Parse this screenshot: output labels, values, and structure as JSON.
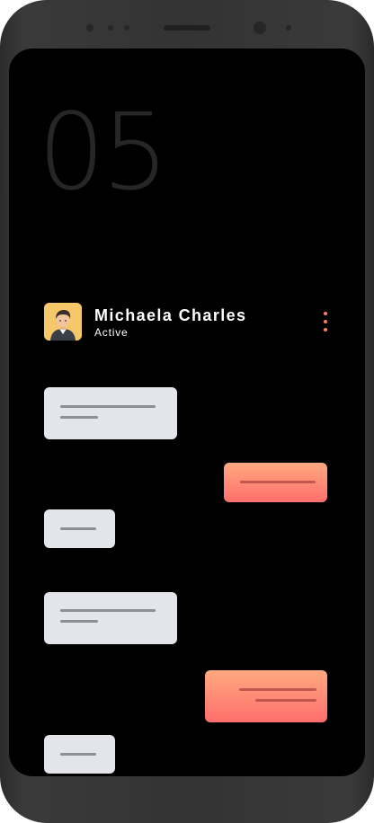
{
  "header": {
    "page_number": "05",
    "contact_name": "Michaela Charles",
    "contact_status": "Active",
    "avatar_icon": "person-avatar-icon",
    "menu_icon": "more-vertical-icon"
  },
  "messages": [
    {
      "direction": "incoming",
      "lines": 2
    },
    {
      "direction": "outgoing",
      "lines": 1
    },
    {
      "direction": "incoming",
      "lines": 1
    },
    {
      "direction": "incoming",
      "lines": 2
    },
    {
      "direction": "outgoing",
      "lines": 2
    },
    {
      "direction": "incoming",
      "lines": 1
    }
  ],
  "colors": {
    "screen_background": "#000000",
    "incoming_bubble": "#e3e5ea",
    "outgoing_bubble_top": "#ffa97f",
    "outgoing_bubble_bottom": "#ff6f6c",
    "accent": "#ff7a6a",
    "avatar_background": "#f6c86a"
  }
}
